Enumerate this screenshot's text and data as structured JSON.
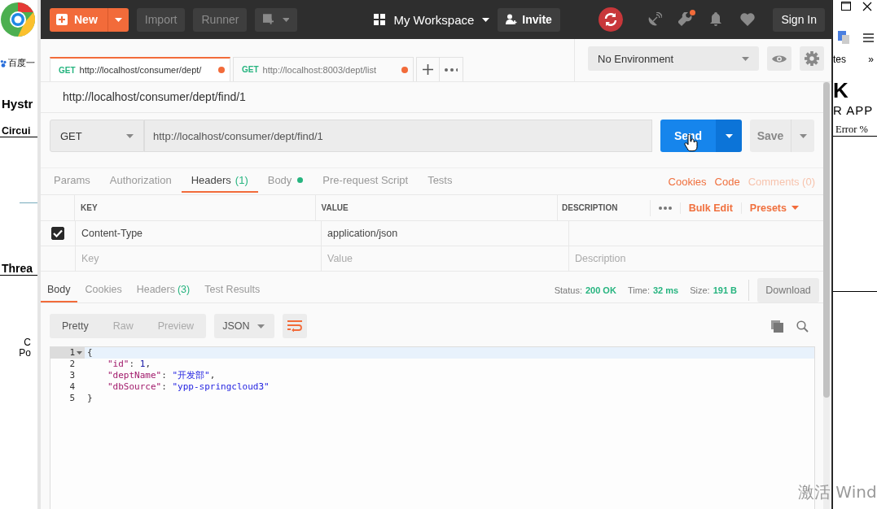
{
  "browser_left": {
    "bookmark": "百度一",
    "heading": "Hystr",
    "subheading": "Circui",
    "section": "Threa",
    "labels": [
      "C",
      "Po"
    ]
  },
  "header": {
    "new_button": "New",
    "import_button": "Import",
    "runner_button": "Runner",
    "workspace": "My Workspace",
    "invite_button": "Invite",
    "notification_badge": true,
    "sign_in_button": "Sign In"
  },
  "request_tabs": [
    {
      "method": "GET",
      "url": "http://localhost/consumer/dept/",
      "unsaved": true,
      "selected": true
    },
    {
      "method": "GET",
      "url": "http://localhost:8003/dept/list",
      "unsaved": true,
      "selected": false
    }
  ],
  "environment": {
    "value": "No Environment"
  },
  "request": {
    "title": "http://localhost/consumer/dept/find/1",
    "method": "GET",
    "url": "http://localhost/consumer/dept/find/1",
    "send_button": "Send",
    "save_button": "Save"
  },
  "request_sections": [
    {
      "label": "Params",
      "selected": false
    },
    {
      "label": "Authorization",
      "selected": false
    },
    {
      "label": "Headers",
      "count": "(1)",
      "selected": true
    },
    {
      "label": "Body",
      "dot": true,
      "selected": false
    },
    {
      "label": "Pre-request Script",
      "selected": false
    },
    {
      "label": "Tests",
      "selected": false
    }
  ],
  "request_links": [
    {
      "label": "Cookies",
      "disabled": false
    },
    {
      "label": "Code",
      "disabled": false
    },
    {
      "label": "Comments (0)",
      "disabled": true
    }
  ],
  "headers_table": {
    "columns": [
      "KEY",
      "VALUE",
      "DESCRIPTION"
    ],
    "actions": [
      "Bulk Edit",
      "Presets"
    ],
    "rows": [
      {
        "checked": true,
        "key": "Content-Type",
        "value": "application/json"
      }
    ],
    "placeholders": {
      "key": "Key",
      "value": "Value",
      "description": "Description"
    }
  },
  "response_tabs": [
    {
      "label": "Body",
      "selected": true
    },
    {
      "label": "Cookies",
      "selected": false
    },
    {
      "label": "Headers",
      "count": "(3)",
      "selected": false
    },
    {
      "label": "Test Results",
      "selected": false
    }
  ],
  "response_meta": [
    {
      "label": "Status:",
      "value": "200 OK"
    },
    {
      "label": "Time:",
      "value": "32 ms"
    },
    {
      "label": "Size:",
      "value": "191 B"
    }
  ],
  "download_button": "Download",
  "view_modes": [
    {
      "label": "Pretty",
      "selected": true
    },
    {
      "label": "Raw",
      "selected": false
    },
    {
      "label": "Preview",
      "selected": false
    }
  ],
  "format": "JSON",
  "code_lines": [
    {
      "number": "1",
      "foldable": true,
      "active": true,
      "indented": false,
      "tokens": [
        {
          "kind": "punct",
          "text": "{"
        }
      ]
    },
    {
      "number": "2",
      "foldable": false,
      "active": false,
      "indented": true,
      "tokens": [
        {
          "kind": "key",
          "text": "\"id\""
        },
        {
          "kind": "punct",
          "text": ": "
        },
        {
          "kind": "number",
          "text": "1"
        },
        {
          "kind": "punct",
          "text": ","
        }
      ]
    },
    {
      "number": "3",
      "foldable": false,
      "active": false,
      "indented": true,
      "tokens": [
        {
          "kind": "key",
          "text": "\"deptName\""
        },
        {
          "kind": "punct",
          "text": ": "
        },
        {
          "kind": "string",
          "text": "\"开发部\""
        },
        {
          "kind": "punct",
          "text": ","
        }
      ]
    },
    {
      "number": "4",
      "foldable": false,
      "active": false,
      "indented": true,
      "tokens": [
        {
          "kind": "key",
          "text": "\"dbSource\""
        },
        {
          "kind": "punct",
          "text": ": "
        },
        {
          "kind": "string",
          "text": "\"ypp-springcloud3\""
        }
      ]
    },
    {
      "number": "5",
      "foldable": false,
      "active": false,
      "indented": false,
      "tokens": [
        {
          "kind": "punct",
          "text": "}"
        }
      ]
    }
  ],
  "browser_right": {
    "bookmark_fragment": "tes",
    "overflow": "»",
    "heading_fragment": "K",
    "subheading_fragment": "R APP",
    "column": "Error %"
  },
  "activation_notice": "激活 Wind"
}
